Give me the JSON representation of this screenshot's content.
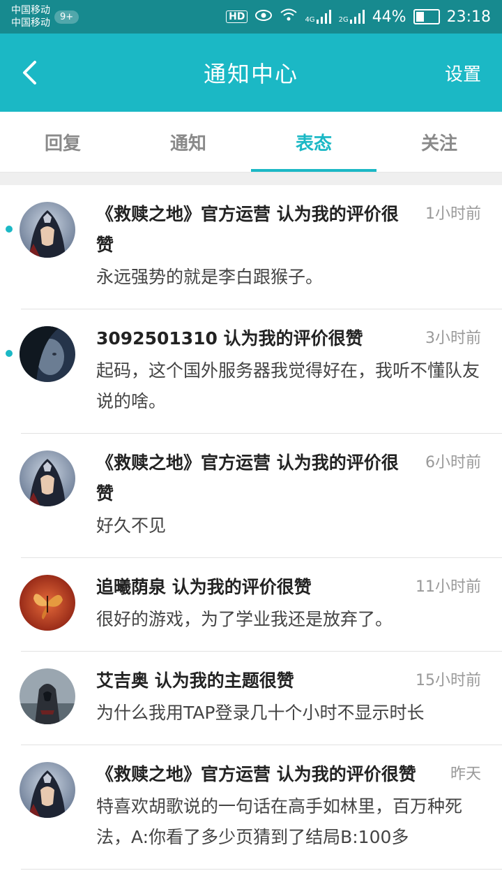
{
  "status": {
    "carrier1": "中国移动",
    "carrier2": "中国移动",
    "badge": "9+",
    "hd": "HD",
    "net1": "4G",
    "net2": "2G",
    "battery": "44%",
    "battery_level": 0.44,
    "time": "23:18"
  },
  "topbar": {
    "title": "通知中心",
    "settings": "设置"
  },
  "tabs": [
    {
      "label": "回复",
      "active": false
    },
    {
      "label": "通知",
      "active": false
    },
    {
      "label": "表态",
      "active": true
    },
    {
      "label": "关注",
      "active": false
    }
  ],
  "items": [
    {
      "headline": "《救赎之地》官方运营 认为我的评价很赞",
      "time": "1小时前",
      "body": "永远强势的就是李白跟猴子。",
      "unread": true,
      "avatar": "hooded-warrior-avatar"
    },
    {
      "headline": "3092501310 认为我的评价很赞",
      "time": "3小时前",
      "body": "起码，这个国外服务器我觉得好在，我听不懂队友说的啥。",
      "unread": true,
      "avatar": "dark-face-avatar"
    },
    {
      "headline": "《救赎之地》官方运营 认为我的评价很赞",
      "time": "6小时前",
      "body": "好久不见",
      "unread": false,
      "avatar": "hooded-warrior-avatar"
    },
    {
      "headline": "追曦荫泉 认为我的评价很赞",
      "time": "11小时前",
      "body": "很好的游戏，为了学业我还是放弃了。",
      "unread": false,
      "avatar": "butterfly-avatar"
    },
    {
      "headline": "艾吉奥 认为我的主题很赞",
      "time": "15小时前",
      "body": "为什么我用TAP登录几十个小时不显示时长",
      "unread": false,
      "avatar": "assassin-avatar"
    },
    {
      "headline": "《救赎之地》官方运营 认为我的评价很赞",
      "time": "昨天",
      "body": "特喜欢胡歌说的一句话在高手如林里，百万种死法，A:你看了多少页猜到了结局B:100多",
      "unread": false,
      "avatar": "hooded-warrior-avatar"
    }
  ]
}
